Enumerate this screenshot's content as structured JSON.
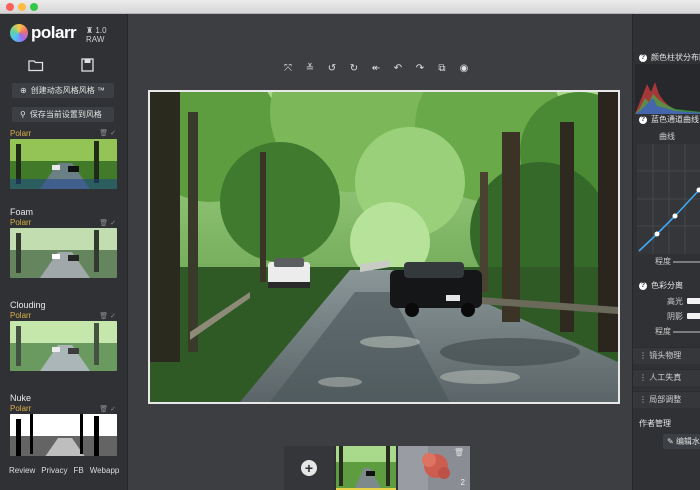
{
  "app": {
    "version": "1.0 RAW",
    "window_dots": [
      "#fc605b",
      "#fdbc40",
      "#34c84a"
    ]
  },
  "left_panel": {
    "buttons": [
      {
        "icon": "plus-circle-icon",
        "label": "创建动态风格风格 ™"
      },
      {
        "icon": "pin-icon",
        "label": "保存当前设置到风格"
      }
    ],
    "filters": [
      {
        "name": "",
        "author": "Polarr"
      },
      {
        "name": "Foam",
        "author": "Polarr"
      },
      {
        "name": "Clouding",
        "author": "Polarr"
      },
      {
        "name": "Nuke",
        "author": "Polarr"
      }
    ],
    "footer_links": [
      "Review",
      "Privacy",
      "FB",
      "Webapp"
    ]
  },
  "toolbar": {
    "icons": [
      "fit-icon",
      "straighten-icon",
      "rotate-left-icon",
      "rotate-right-icon",
      "undo-all-icon",
      "undo-icon",
      "redo-icon",
      "compare-icon",
      "preview-eye-icon"
    ]
  },
  "filmstrip": {
    "add_label": "+",
    "count": "2"
  },
  "right_panel": {
    "histogram_title": "颜色柱状分布图",
    "curve_section": "蓝色通道曲线",
    "curve_label": "曲线",
    "degree_label": "程度",
    "split_title": "色彩分离",
    "highlights": "高光",
    "shadows": "阴影",
    "degree_label2": "程度",
    "sections": [
      "镜头物理",
      "人工失真",
      "局部调整"
    ],
    "author_title": "作者管理",
    "edit_button": "编辑水"
  },
  "colors": {
    "accent_yellow": "#d8b048",
    "curve_blue": "#3fa9f5"
  }
}
